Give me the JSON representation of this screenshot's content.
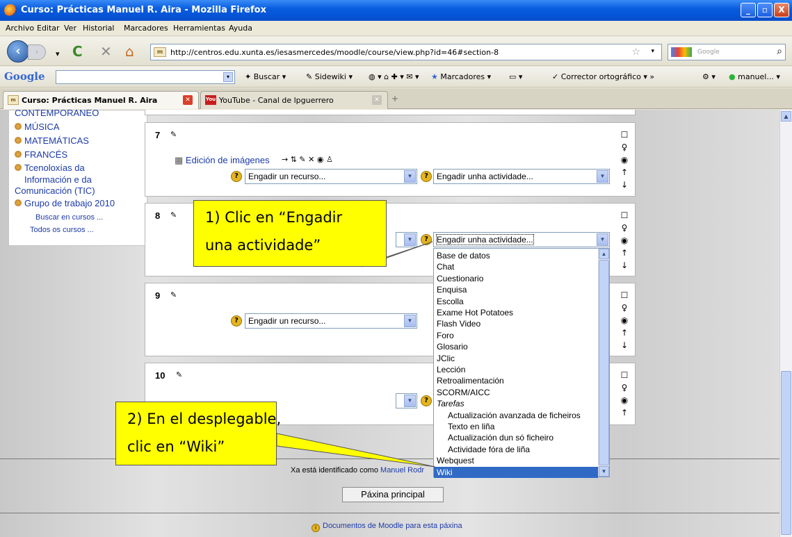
{
  "window": {
    "title": "Curso: Prácticas Manuel R. Aira - Mozilla Firefox",
    "controls": [
      "_",
      "▫",
      "X"
    ]
  },
  "menu": [
    "Archivo",
    "Editar",
    "Ver",
    "Historial",
    "Marcadores",
    "Herramientas",
    "Ayuda"
  ],
  "nav": {
    "url": "http://centros.edu.xunta.es/iesasmercedes/moodle/course/view.php?id=46#section-8",
    "search_placeholder": "Google"
  },
  "google_toolbar": {
    "logo": "Google",
    "buttons": [
      "Buscar",
      "Sidewiki",
      "Marcadores",
      "Corrector ortográfico",
      "manuel..."
    ]
  },
  "tabs": [
    {
      "label": "Curso: Prácticas Manuel R. Aira",
      "active": true
    },
    {
      "label": "YouTube - Canal de lpguerrero",
      "active": false
    }
  ],
  "sidebar": {
    "cut_item": "CONTEMPORÁNEO",
    "items": [
      "MÚSICA",
      "MATEMÁTICAS",
      "FRANCÉS",
      "Tcenoloxías da",
      "Información e da",
      "Comunicación (TIC)",
      "Grupo de trabajo 2010"
    ],
    "links": [
      "Buscar en cursos ...",
      "Todos os cursos ..."
    ]
  },
  "sections": [
    {
      "number": "7",
      "resource_name": "Edición de imágenes",
      "resource_select": "Engadir un recurso...",
      "activity_select": "Engadir unha actividade..."
    },
    {
      "number": "8",
      "activity_select": "Engadir unha actividade..."
    },
    {
      "number": "9",
      "resource_select": "Engadir un recurso..."
    },
    {
      "number": "10"
    }
  ],
  "dropdown": {
    "options": [
      {
        "label": "Base de datos",
        "type": "opt"
      },
      {
        "label": "Chat",
        "type": "opt"
      },
      {
        "label": "Cuestionario",
        "type": "opt"
      },
      {
        "label": "Enquisa",
        "type": "opt"
      },
      {
        "label": "Escolla",
        "type": "opt"
      },
      {
        "label": "Exame Hot Potatoes",
        "type": "opt"
      },
      {
        "label": "Flash Video",
        "type": "opt"
      },
      {
        "label": "Foro",
        "type": "opt"
      },
      {
        "label": "Glosario",
        "type": "opt"
      },
      {
        "label": "JClic",
        "type": "opt"
      },
      {
        "label": "Lección",
        "type": "opt"
      },
      {
        "label": "Retroalimentación",
        "type": "opt"
      },
      {
        "label": "SCORM/AICC",
        "type": "opt"
      },
      {
        "label": "Tarefas",
        "type": "group"
      },
      {
        "label": "Actualización avanzada de ficheiros",
        "type": "indent"
      },
      {
        "label": "Texto en liña",
        "type": "indent"
      },
      {
        "label": "Actualización dun só ficheiro",
        "type": "indent"
      },
      {
        "label": "Actividade fóra de liña",
        "type": "indent"
      },
      {
        "label": "Webquest",
        "type": "opt"
      },
      {
        "label": "Wiki",
        "type": "selected"
      }
    ]
  },
  "callouts": {
    "first": {
      "line1": "1) Clic en “Engadir",
      "line2": "una actividade”"
    },
    "second": {
      "line1": "2) En el desplegable,",
      "line2": "clic en “Wiki”"
    }
  },
  "footer": {
    "logged_in_prefix": "Xa está identificado como",
    "user_name": "Manuel Rodr",
    "home_button": "Páxina principal",
    "docs_link": "Documentos de Moodle para esta páxina"
  },
  "colors": {
    "titlebar": "#0a5ee0",
    "link": "#1c3aa8",
    "callout": "#ffff00",
    "selected": "#316ac5"
  }
}
